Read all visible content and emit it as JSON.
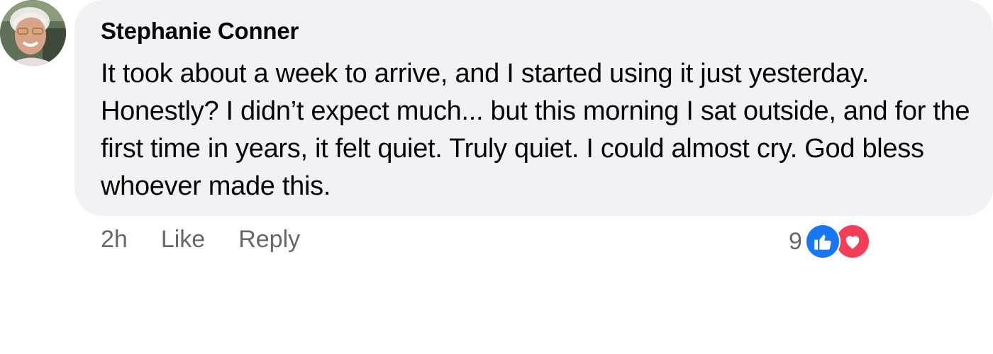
{
  "comment": {
    "author": "Stephanie Conner",
    "text": "It took about a week to arrive, and I started using it just yesterday. Honestly? I didn’t expect much... but this morning I sat outside, and for the first time in years, it felt quiet. Truly quiet. I could almost cry. God bless whoever made this.",
    "timestamp": "2h",
    "like_label": "Like",
    "reply_label": "Reply",
    "reaction_count": "9",
    "reactions": [
      "like-icon",
      "love-icon"
    ]
  },
  "colors": {
    "bubble": "#f0f2f5",
    "meta_text": "#65676b",
    "like_blue": "#1877f2",
    "love_red": "#f33e58"
  }
}
